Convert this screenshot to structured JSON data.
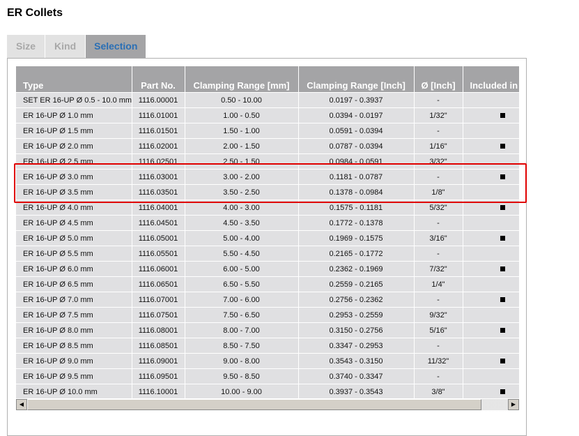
{
  "title": "ER Collets",
  "tabs": [
    "Size",
    "Kind",
    "Selection"
  ],
  "columns": [
    "Type",
    "Part No.",
    "Clamping Range [mm]",
    "Clamping Range [Inch]",
    "Ø [Inch]",
    "Included in"
  ],
  "rows": [
    [
      "SET ER 16-UP Ø 0.5 - 10.0 mm",
      "1116.00001",
      "0.50 - 10.00",
      "0.0197 - 0.3937",
      "-",
      false
    ],
    [
      "ER 16-UP Ø 1.0 mm",
      "1116.01001",
      "1.00 - 0.50",
      "0.0394 - 0.0197",
      "1/32\"",
      true
    ],
    [
      "ER 16-UP Ø 1.5 mm",
      "1116.01501",
      "1.50 - 1.00",
      "0.0591 - 0.0394",
      "-",
      false
    ],
    [
      "ER 16-UP Ø 2.0 mm",
      "1116.02001",
      "2.00 - 1.50",
      "0.0787 - 0.0394",
      "1/16\"",
      true
    ],
    [
      "ER 16-UP Ø 2.5 mm",
      "1116.02501",
      "2.50 - 1.50",
      "0.0984 - 0.0591",
      "3/32\"",
      false
    ],
    [
      "ER 16-UP Ø 3.0 mm",
      "1116.03001",
      "3.00 - 2.00",
      "0.1181 - 0.0787",
      "-",
      true
    ],
    [
      "ER 16-UP Ø 3.5 mm",
      "1116.03501",
      "3.50 - 2.50",
      "0.1378 - 0.0984",
      "1/8\"",
      false
    ],
    [
      "ER 16-UP Ø 4.0 mm",
      "1116.04001",
      "4.00 - 3.00",
      "0.1575 - 0.1181",
      "5/32\"",
      true
    ],
    [
      "ER 16-UP Ø 4.5 mm",
      "1116.04501",
      "4.50 - 3.50",
      "0.1772 - 0.1378",
      "-",
      false
    ],
    [
      "ER 16-UP Ø 5.0 mm",
      "1116.05001",
      "5.00 - 4.00",
      "0.1969 - 0.1575",
      "3/16\"",
      true
    ],
    [
      "ER 16-UP Ø 5.5 mm",
      "1116.05501",
      "5.50 - 4.50",
      "0.2165 - 0.1772",
      "-",
      false
    ],
    [
      "ER 16-UP Ø 6.0 mm",
      "1116.06001",
      "6.00 - 5.00",
      "0.2362 - 0.1969",
      "7/32\"",
      true
    ],
    [
      "ER 16-UP Ø 6.5 mm",
      "1116.06501",
      "6.50 - 5.50",
      "0.2559 - 0.2165",
      "1/4\"",
      false
    ],
    [
      "ER 16-UP Ø 7.0 mm",
      "1116.07001",
      "7.00 - 6.00",
      "0.2756 - 0.2362",
      "-",
      true
    ],
    [
      "ER 16-UP Ø 7.5 mm",
      "1116.07501",
      "7.50 - 6.50",
      "0.2953 - 0.2559",
      "9/32\"",
      false
    ],
    [
      "ER 16-UP Ø 8.0 mm",
      "1116.08001",
      "8.00 - 7.00",
      "0.3150 - 0.2756",
      "5/16\"",
      true
    ],
    [
      "ER 16-UP Ø 8.5 mm",
      "1116.08501",
      "8.50 - 7.50",
      "0.3347 - 0.2953",
      "-",
      false
    ],
    [
      "ER 16-UP Ø 9.0 mm",
      "1116.09001",
      "9.00 - 8.00",
      "0.3543 - 0.3150",
      "11/32\"",
      true
    ],
    [
      "ER 16-UP Ø 9.5 mm",
      "1116.09501",
      "9.50 - 8.50",
      "0.3740 - 0.3347",
      "-",
      false
    ],
    [
      "ER 16-UP Ø 10.0 mm",
      "1116.10001",
      "10.00 - 9.00",
      "0.3937 - 0.3543",
      "3/8\"",
      true
    ]
  ],
  "highlighted_rows": [
    5,
    6
  ],
  "highlight_color": "#e00000"
}
